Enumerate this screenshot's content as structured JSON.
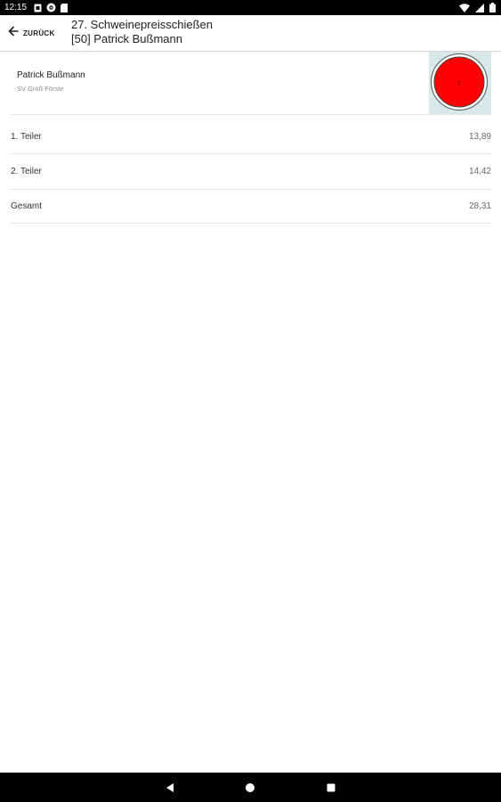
{
  "status_bar": {
    "time": "12:15",
    "left_icons": [
      "notification-icon",
      "cast-icon",
      "sd-card-icon"
    ],
    "right_icons": [
      "wifi-icon",
      "signal-icon",
      "battery-icon"
    ]
  },
  "app_bar": {
    "back_label": "ZURÜCK",
    "title_line1": "27. Schweinepreisschießen",
    "title_line2": "[50] Patrick Bußmann"
  },
  "shooter": {
    "name": "Patrick Bußmann",
    "club": "SV Groß Förste",
    "target_marker": "2",
    "target_color": "#ff0000",
    "target_bg": "#d8e8e8"
  },
  "results": [
    {
      "label": "1. Teiler",
      "value": "13,89"
    },
    {
      "label": "2. Teiler",
      "value": "14,42"
    },
    {
      "label": "Gesamt",
      "value": "28,31"
    }
  ],
  "nav_bar": {
    "buttons": [
      "back-triangle-icon",
      "home-circle-icon",
      "recents-square-icon"
    ]
  }
}
